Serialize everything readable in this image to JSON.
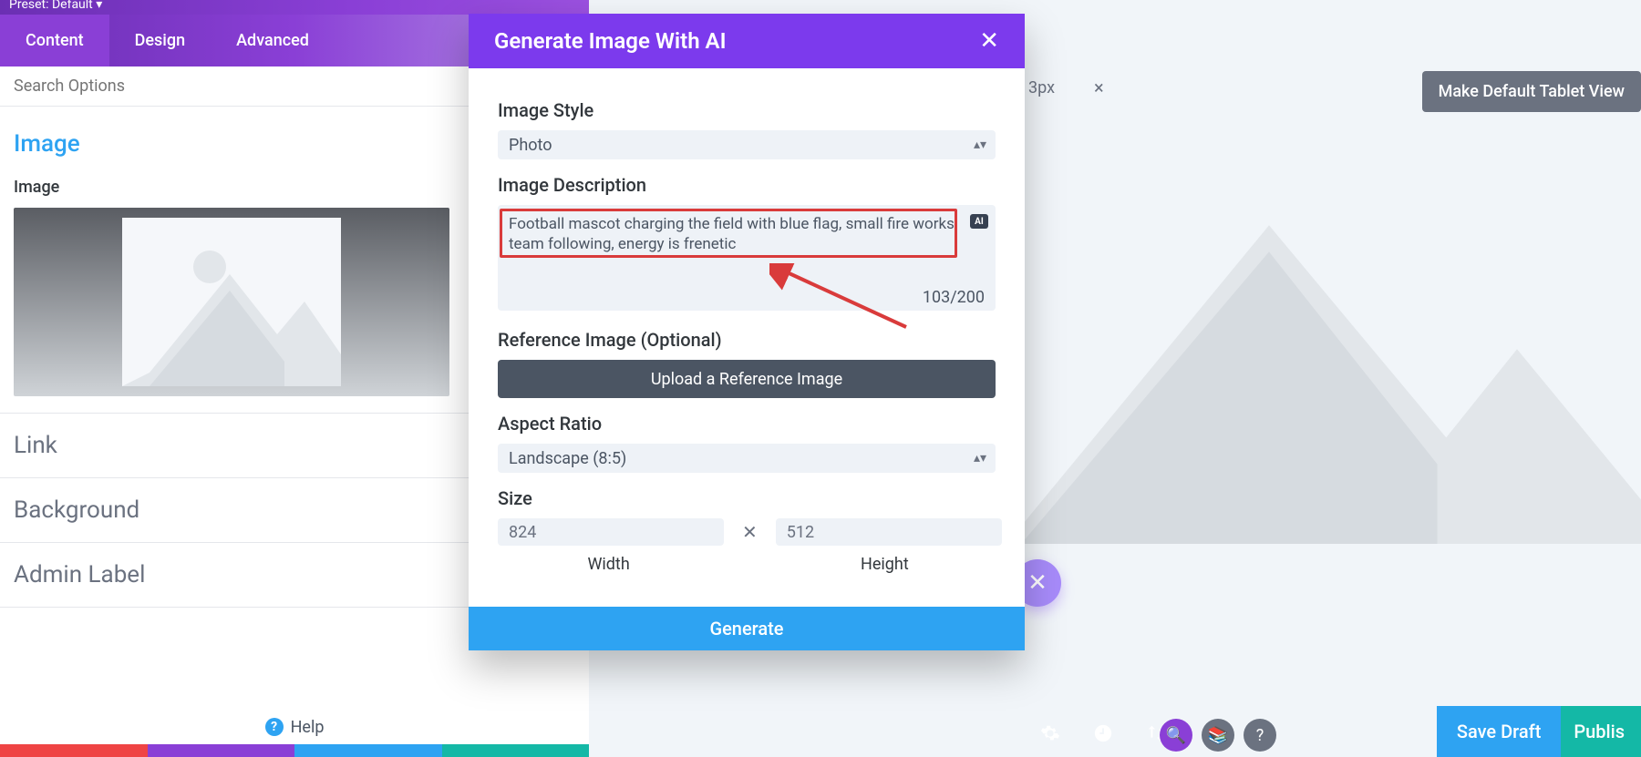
{
  "preset": {
    "label": "Preset: Default ▾"
  },
  "tabs": {
    "content": "Content",
    "design": "Design",
    "advanced": "Advanced"
  },
  "search_placeholder": "Search Options",
  "sections": {
    "image_title": "Image",
    "image_field_label": "Image",
    "link": "Link",
    "background": "Background",
    "admin_label": "Admin Label"
  },
  "help": {
    "label": "Help"
  },
  "right_bar": {
    "px_value": "3px",
    "default_view": "Make Default Tablet View"
  },
  "save_publish": {
    "save_draft": "Save Draft",
    "publish": "Publis"
  },
  "modal": {
    "title": "Generate Image With AI",
    "image_style_label": "Image Style",
    "image_style_value": "Photo",
    "image_description_label": "Image Description",
    "image_description_value": "Football mascot charging the field with blue flag, small fire works, team following, energy is frenetic",
    "char_count": "103/200",
    "ai_badge": "AI",
    "reference_label": "Reference Image (Optional)",
    "upload_btn": "Upload a Reference Image",
    "aspect_ratio_label": "Aspect Ratio",
    "aspect_ratio_value": "Landscape (8:5)",
    "size_label": "Size",
    "width_value": "824",
    "height_value": "512",
    "width_label": "Width",
    "height_label": "Height",
    "generate": "Generate"
  }
}
